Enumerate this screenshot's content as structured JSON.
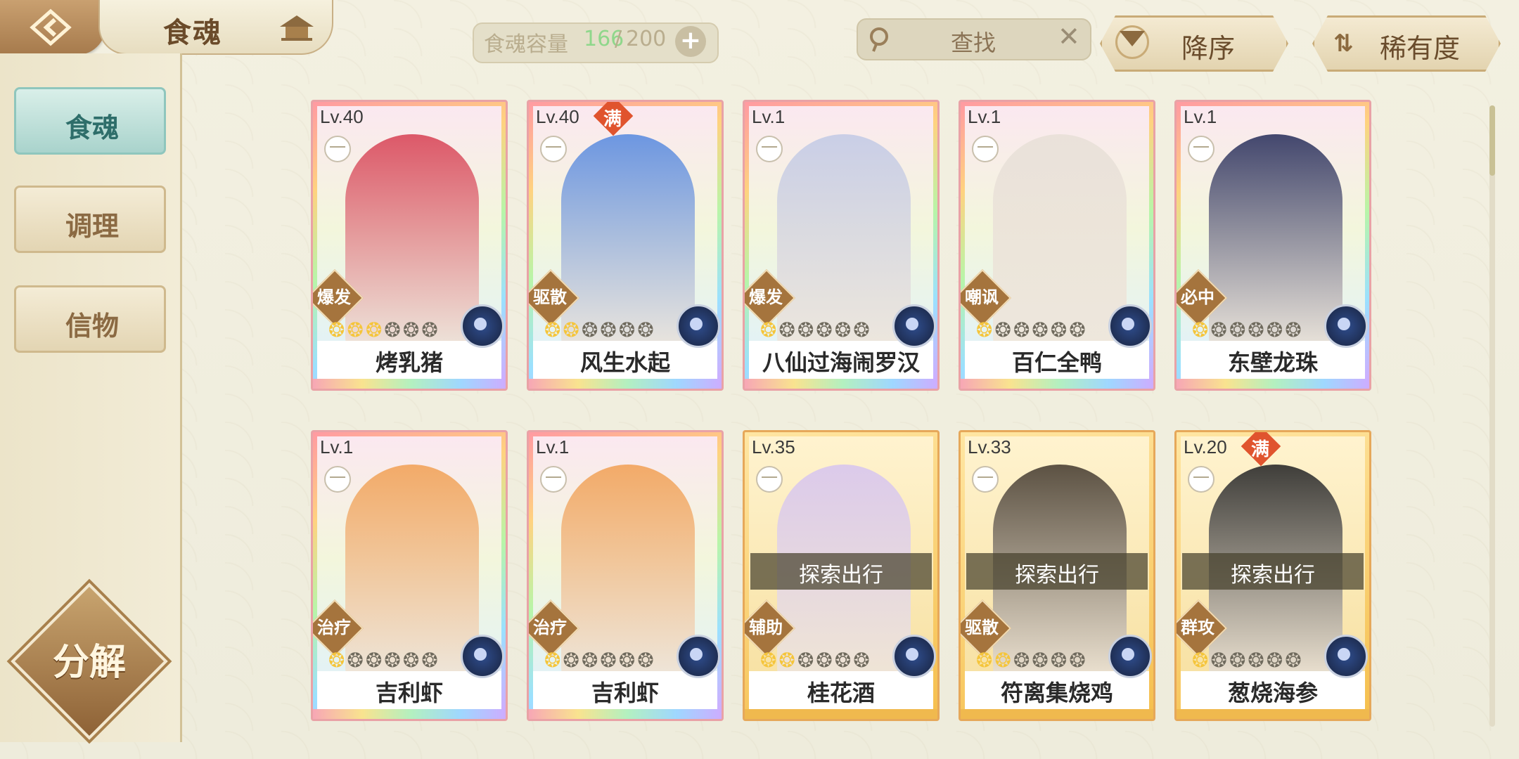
{
  "header": {
    "title": "食魂",
    "capacity_label": "食魂容量",
    "capacity_current": "166",
    "capacity_slash": "/",
    "capacity_max": "200",
    "add_label": "+",
    "search_label": "查找",
    "clear_label": "✕",
    "sort_label": "降序",
    "rarity_label": "稀有度"
  },
  "sidebar": {
    "items": [
      {
        "label": "食魂",
        "active": true
      },
      {
        "label": "调理",
        "active": false
      },
      {
        "label": "信物",
        "active": false
      }
    ],
    "decompose_label": "分解"
  },
  "cards": [
    {
      "level": "Lv.40",
      "name": "烤乳猪",
      "role": "爆发",
      "stars_on": 3,
      "stars_total": 6,
      "frame": "rainbow",
      "full": false,
      "full_label": "",
      "explore": false,
      "explore_label": "",
      "lock": "一"
    },
    {
      "level": "Lv.40",
      "name": "风生水起",
      "role": "驱散",
      "stars_on": 2,
      "stars_total": 6,
      "frame": "rainbow",
      "full": true,
      "full_label": "满",
      "explore": false,
      "explore_label": "",
      "lock": "一"
    },
    {
      "level": "Lv.1",
      "name": "八仙过海闹罗汉",
      "role": "爆发",
      "stars_on": 1,
      "stars_total": 6,
      "frame": "rainbow",
      "full": false,
      "full_label": "",
      "explore": false,
      "explore_label": "",
      "lock": "一"
    },
    {
      "level": "Lv.1",
      "name": "百仁全鸭",
      "role": "嘲讽",
      "stars_on": 1,
      "stars_total": 6,
      "frame": "rainbow",
      "full": false,
      "full_label": "",
      "explore": false,
      "explore_label": "",
      "lock": "一"
    },
    {
      "level": "Lv.1",
      "name": "东壁龙珠",
      "role": "必中",
      "stars_on": 1,
      "stars_total": 6,
      "frame": "rainbow",
      "full": false,
      "full_label": "",
      "explore": false,
      "explore_label": "",
      "lock": "一"
    },
    {
      "level": "Lv.1",
      "name": "吉利虾",
      "role": "治疗",
      "stars_on": 1,
      "stars_total": 6,
      "frame": "rainbow",
      "full": false,
      "full_label": "",
      "explore": false,
      "explore_label": "",
      "lock": "一"
    },
    {
      "level": "Lv.1",
      "name": "吉利虾",
      "role": "治疗",
      "stars_on": 1,
      "stars_total": 6,
      "frame": "rainbow",
      "full": false,
      "full_label": "",
      "explore": false,
      "explore_label": "",
      "lock": "一"
    },
    {
      "level": "Lv.35",
      "name": "桂花酒",
      "role": "辅助",
      "stars_on": 2,
      "stars_total": 6,
      "frame": "gold",
      "full": false,
      "full_label": "",
      "explore": true,
      "explore_label": "探索出行",
      "lock": "一"
    },
    {
      "level": "Lv.33",
      "name": "符离集烧鸡",
      "role": "驱散",
      "stars_on": 2,
      "stars_total": 6,
      "frame": "gold",
      "full": false,
      "full_label": "",
      "explore": true,
      "explore_label": "探索出行",
      "lock": "一"
    },
    {
      "level": "Lv.20",
      "name": "葱烧海参",
      "role": "群攻",
      "stars_on": 1,
      "stars_total": 6,
      "frame": "gold",
      "full": true,
      "full_label": "满",
      "explore": true,
      "explore_label": "探索出行",
      "lock": "一"
    }
  ],
  "colors": {
    "accent_gold": "#c9ab77",
    "active_tab": "#a9d3cc",
    "capacity_green": "#8fd78b",
    "full_badge": "#e0542e"
  }
}
